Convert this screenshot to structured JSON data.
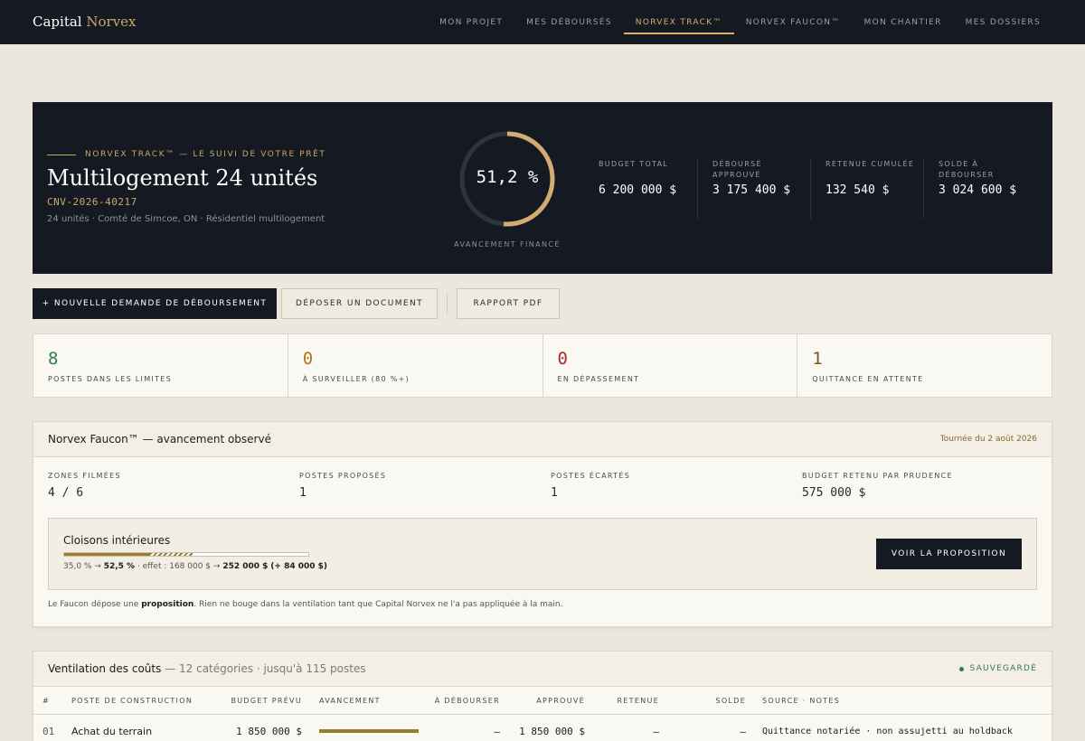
{
  "brand": {
    "name": "Capital",
    "accent": "Norvex"
  },
  "nav": {
    "items": [
      "MON PROJET",
      "MES DÉBOURSÉS",
      "NORVEX TRACK™",
      "NORVEX FAUCON™",
      "MON CHANTIER",
      "MES DOSSIERS"
    ],
    "active": "NORVEX TRACK™"
  },
  "hero": {
    "eyebrow": "NORVEX TRACK™ — LE SUIVI DE VOTRE PRÊT",
    "title": "Multilogement 24 unités",
    "code": "CNV-2026-40217",
    "subtitle": "24 unités · Comté de Simcoe, ON · Résidentiel multilogement",
    "progress_value": "51,2 %",
    "progress_fraction": 0.512,
    "progress_label": "AVANCEMENT FINANCÉ",
    "stats": [
      {
        "label": "BUDGET TOTAL",
        "value": "6 200 000 $"
      },
      {
        "label": "DÉBOURSÉ APPROUVÉ",
        "value": "3 175 400 $"
      },
      {
        "label": "RETENUE CUMULÉE",
        "value": "132 540 $"
      },
      {
        "label": "SOLDE À DÉBOURSER",
        "value": "3 024 600 $"
      }
    ]
  },
  "actions": {
    "new_request": "+ NOUVELLE DEMANDE DE DÉBOURSEMENT",
    "upload": "DÉPOSER UN DOCUMENT",
    "report": "RAPPORT PDF"
  },
  "metrics": [
    {
      "value": "8",
      "label": "POSTES DANS LES LIMITES",
      "color": "#2e7d4f"
    },
    {
      "value": "0",
      "label": "À SURVEILLER (80 %+)",
      "color": "#b07a1a"
    },
    {
      "value": "0",
      "label": "EN DÉPASSEMENT",
      "color": "#b02a2a"
    },
    {
      "value": "1",
      "label": "QUITTANCE EN ATTENTE",
      "color": "#7a5a1a"
    }
  ],
  "faucon": {
    "title": "Norvex Faucon™ — avancement observé",
    "tour_date": "Tournée du 2 août 2026",
    "stats": [
      {
        "label": "ZONES FILMÉES",
        "value": "4 / 6"
      },
      {
        "label": "POSTES PROPOSÉS",
        "value": "1"
      },
      {
        "label": "POSTES ÉCARTÉS",
        "value": "1"
      },
      {
        "label": "BUDGET RETENU PAR PRUDENCE",
        "value": "575 000 $"
      }
    ],
    "proposal": {
      "title": "Cloisons intérieures",
      "from_pct": "35,0 %",
      "to_pct": "52,5 %",
      "from_fraction": 0.35,
      "to_fraction": 0.525,
      "effect_label": "effet : 168 000 $",
      "new_amount": "252 000 $",
      "delta": "(+ 84 000 $)",
      "button": "VOIR LA PROPOSITION"
    },
    "note_prefix": "Le Faucon dépose une ",
    "note_bold": "proposition",
    "note_suffix": ". Rien ne bouge dans la ventilation tant que Capital Norvex ne l'a pas appliquée à la main."
  },
  "costs": {
    "title": "Ventilation des coûts",
    "subtitle": "— 12 catégories · jusqu'à 115 postes",
    "saved": "SAUVEGARDÉ",
    "columns": [
      "#",
      "POSTE DE CONSTRUCTION",
      "BUDGET PRÉVU",
      "AVANCEMENT",
      "À DÉBOURSER",
      "APPROUVÉ",
      "RETENUE",
      "SOLDE",
      "SOURCE · NOTES"
    ],
    "rows": [
      {
        "num": "01",
        "name": "Achat du terrain",
        "budget": "1 850 000 $",
        "progress": 1.0,
        "to_disburse": "—",
        "approved": "1 850 000 $",
        "holdback": "—",
        "balance": "—",
        "notes": "Quittance notariée · non assujetti au holdback"
      }
    ]
  }
}
